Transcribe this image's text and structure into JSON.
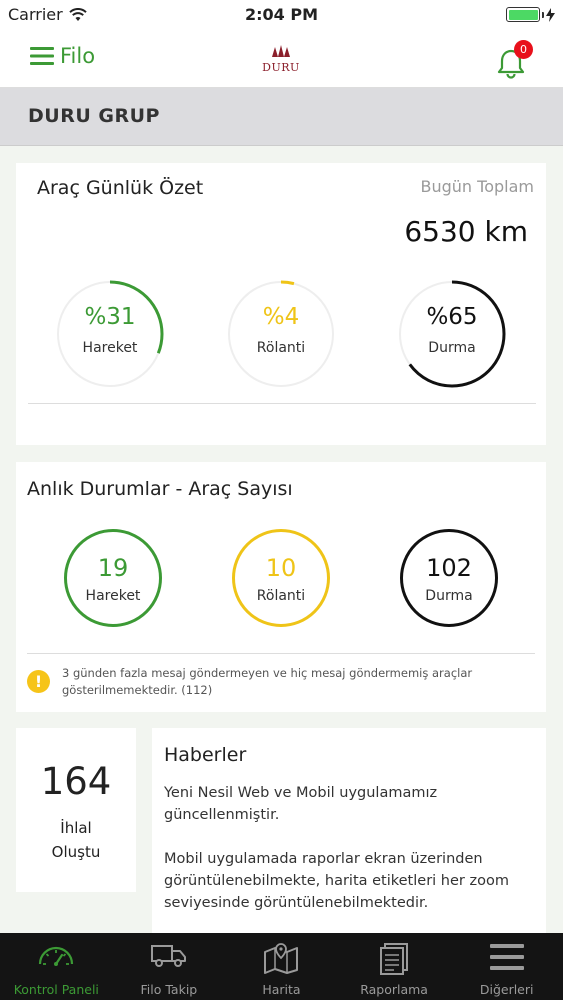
{
  "status_bar": {
    "carrier": "Carrier",
    "time": "2:04 PM"
  },
  "nav": {
    "menu_label": "Filo",
    "logo_text": "DURU",
    "notification_count": "0"
  },
  "company": {
    "name": "DURU GRUP"
  },
  "daily_summary": {
    "title": "Araç Günlük Özet",
    "today_label": "Bugün Toplam",
    "today_value": "6530 km",
    "gauges": [
      {
        "value": "%31",
        "label": "Hareket",
        "percent": 31,
        "color": "#3c9a35"
      },
      {
        "value": "%4",
        "label": "Rölanti",
        "percent": 4,
        "color": "#efc418"
      },
      {
        "value": "%65",
        "label": "Durma",
        "percent": 65,
        "color": "#111111"
      }
    ]
  },
  "instant_status": {
    "title": "Anlık Durumlar - Araç Sayısı",
    "counts": [
      {
        "value": "19",
        "label": "Hareket",
        "color": "#3c9a35"
      },
      {
        "value": "10",
        "label": "Rölanti",
        "color": "#efc418"
      },
      {
        "value": "102",
        "label": "Durma",
        "color": "#111111"
      }
    ],
    "warning": "3 günden fazla mesaj göndermeyen ve hiç mesaj göndermemiş araçlar gösterilmemektedir. (112)"
  },
  "violations": {
    "count": "164",
    "label_line1": "İhlal",
    "label_line2": "Oluştu"
  },
  "news": {
    "title": "Haberler",
    "paragraphs": [
      "Yeni Nesil Web ve Mobil uygulamamız güncellenmiştir.",
      "Mobil uygulamada raporlar ekran üzerinden görüntülenebilmekte, harita etiketleri her zoom seviyesinde görüntülenebilmektedir."
    ]
  },
  "tabs": [
    {
      "label": "Kontrol Paneli",
      "icon": "speedometer-icon",
      "active": true
    },
    {
      "label": "Filo Takip",
      "icon": "truck-icon",
      "active": false
    },
    {
      "label": "Harita",
      "icon": "map-icon",
      "active": false
    },
    {
      "label": "Raporlama",
      "icon": "report-icon",
      "active": false
    },
    {
      "label": "Diğerleri",
      "icon": "menu-icon",
      "active": false
    }
  ],
  "colors": {
    "accent": "#3c9a35",
    "badge": "#e8101b",
    "warning": "#f6c419"
  }
}
